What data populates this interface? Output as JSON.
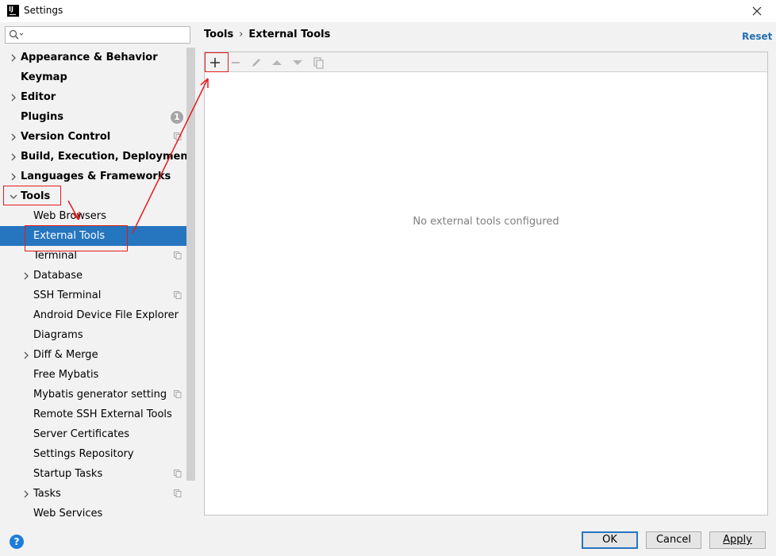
{
  "window": {
    "title": "Settings"
  },
  "search": {
    "placeholder": ""
  },
  "tree": [
    {
      "label": "Appearance & Behavior",
      "level": 0,
      "chevron": "right"
    },
    {
      "label": "Keymap",
      "level": 0
    },
    {
      "label": "Editor",
      "level": 0,
      "chevron": "right"
    },
    {
      "label": "Plugins",
      "level": 0,
      "badge": "1"
    },
    {
      "label": "Version Control",
      "level": 0,
      "chevron": "right",
      "project_icon": true
    },
    {
      "label": "Build, Execution, Deployment",
      "level": 0,
      "chevron": "right"
    },
    {
      "label": "Languages & Frameworks",
      "level": 0,
      "chevron": "right"
    },
    {
      "label": "Tools",
      "level": 0,
      "chevron": "down"
    },
    {
      "label": "Web Browsers",
      "level": 1
    },
    {
      "label": "External Tools",
      "level": 1,
      "selected": true
    },
    {
      "label": "Terminal",
      "level": 1,
      "project_icon": true
    },
    {
      "label": "Database",
      "level": 1,
      "chevron": "right"
    },
    {
      "label": "SSH Terminal",
      "level": 1,
      "project_icon": true
    },
    {
      "label": "Android Device File Explorer",
      "level": 1
    },
    {
      "label": "Diagrams",
      "level": 1
    },
    {
      "label": "Diff & Merge",
      "level": 1,
      "chevron": "right"
    },
    {
      "label": "Free Mybatis",
      "level": 1
    },
    {
      "label": "Mybatis generator setting",
      "level": 1,
      "project_icon": true
    },
    {
      "label": "Remote SSH External Tools",
      "level": 1
    },
    {
      "label": "Server Certificates",
      "level": 1
    },
    {
      "label": "Settings Repository",
      "level": 1
    },
    {
      "label": "Startup Tasks",
      "level": 1,
      "project_icon": true
    },
    {
      "label": "Tasks",
      "level": 1,
      "chevron": "right",
      "project_icon": true
    },
    {
      "label": "Web Services",
      "level": 1
    }
  ],
  "breadcrumb": {
    "parent": "Tools",
    "separator": "›",
    "current": "External Tools"
  },
  "reset_label": "Reset",
  "toolbar": {
    "buttons": [
      "add-icon",
      "remove-icon",
      "edit-icon",
      "move-up-icon",
      "move-down-icon",
      "copy-icon"
    ]
  },
  "content": {
    "empty_text": "No external tools configured"
  },
  "footer": {
    "help": "?",
    "ok": "OK",
    "cancel": "Cancel",
    "apply": "Apply"
  },
  "colors": {
    "selection": "#2675bf",
    "accent_link": "#2470b3",
    "annotation": "#e8191a"
  }
}
